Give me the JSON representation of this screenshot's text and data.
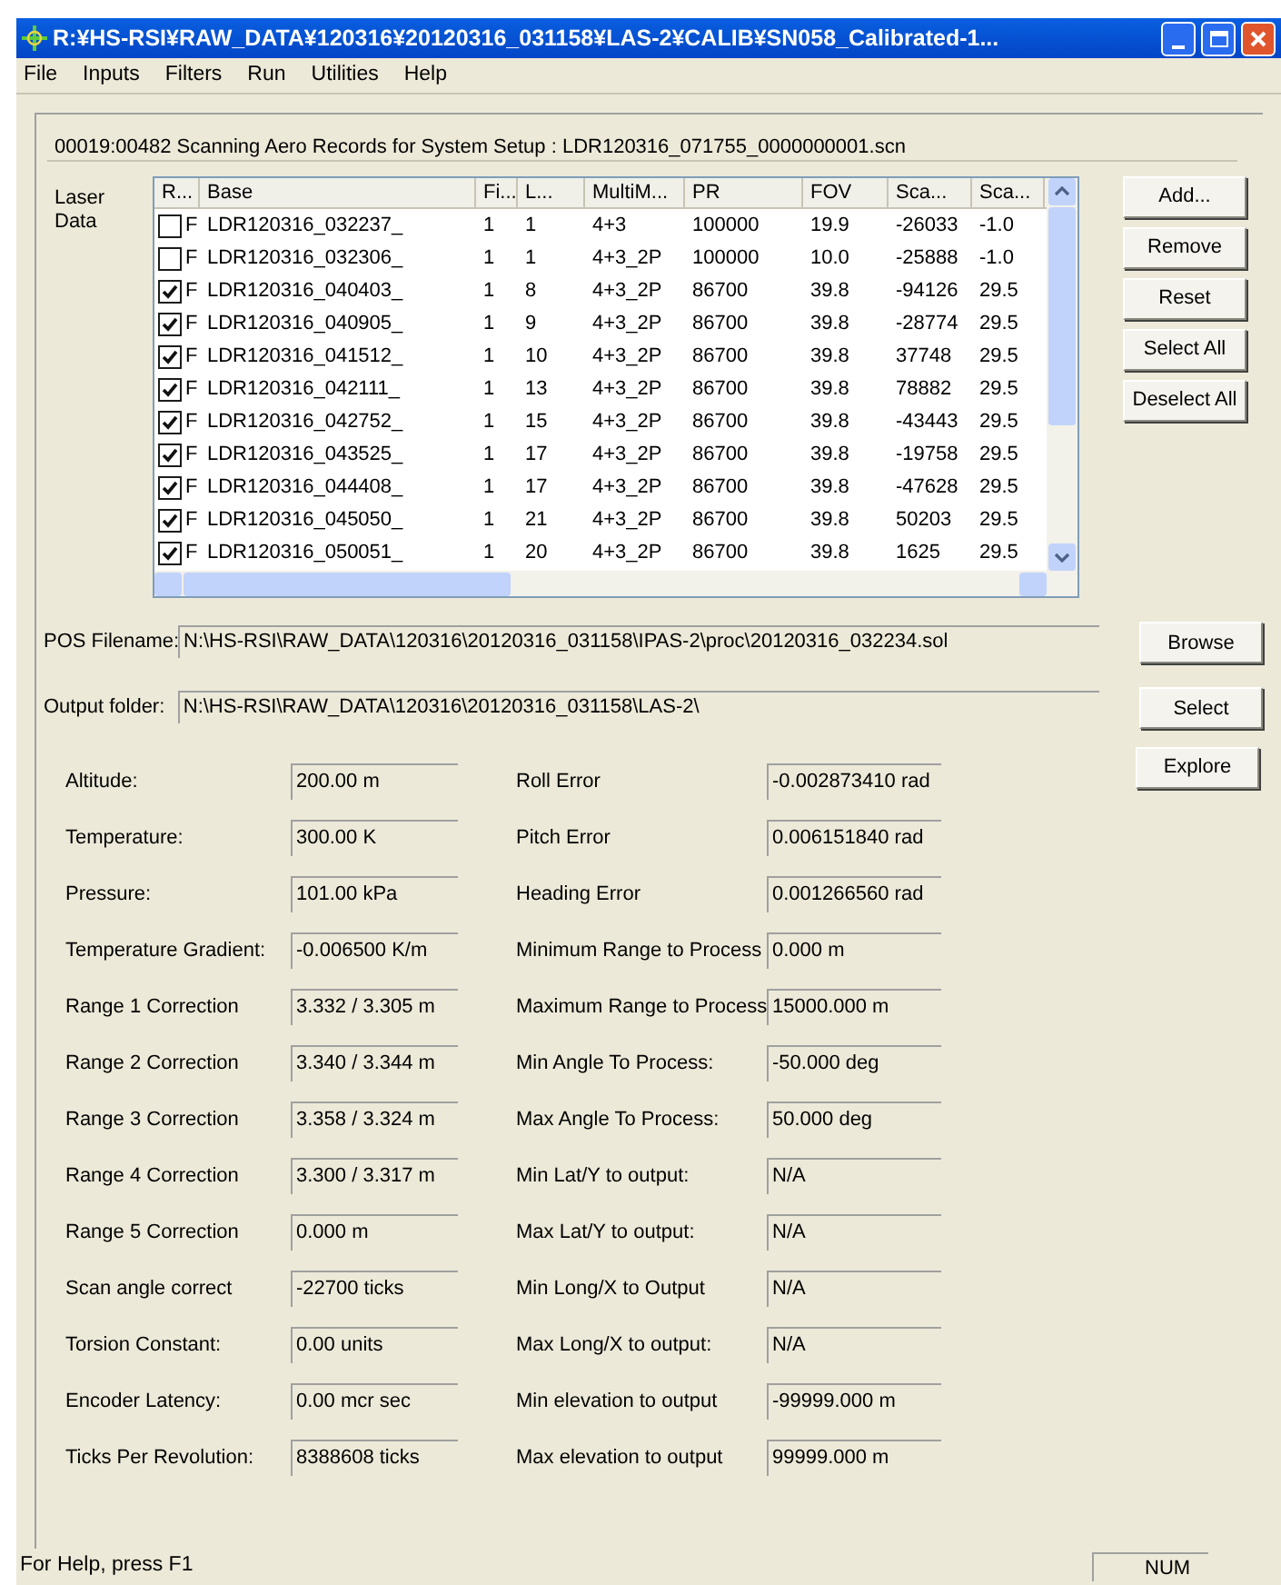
{
  "window": {
    "title": "R:¥HS-RSI¥RAW_DATA¥120316¥20120316_031158¥LAS-2¥CALIB¥SN058_Calibrated-1..."
  },
  "menu": [
    "File",
    "Inputs",
    "Filters",
    "Run",
    "Utilities",
    "Help"
  ],
  "info_line": "00019:00482  Scanning Aero Records for System Setup : LDR120316_071755_0000000001.scn",
  "laser_data": {
    "label": "Laser Data",
    "columns": [
      "R...",
      "Base",
      "Fi...",
      "L...",
      "MultiM...",
      "PR",
      "FOV",
      "Sca...",
      "Sca..."
    ],
    "rows": [
      {
        "checked": false,
        "cells": [
          "F",
          "LDR120316_032237_",
          "1",
          "1",
          "4+3",
          "100000",
          "19.9",
          "-26033",
          "-1.0"
        ]
      },
      {
        "checked": false,
        "cells": [
          "F",
          "LDR120316_032306_",
          "1",
          "1",
          "4+3_2P",
          "100000",
          "10.0",
          "-25888",
          "-1.0"
        ]
      },
      {
        "checked": true,
        "cells": [
          "F",
          "LDR120316_040403_",
          "1",
          "8",
          "4+3_2P",
          "86700",
          "39.8",
          "-94126",
          "29.5"
        ]
      },
      {
        "checked": true,
        "cells": [
          "F",
          "LDR120316_040905_",
          "1",
          "9",
          "4+3_2P",
          "86700",
          "39.8",
          "-28774",
          "29.5"
        ]
      },
      {
        "checked": true,
        "cells": [
          "F",
          "LDR120316_041512_",
          "1",
          "10",
          "4+3_2P",
          "86700",
          "39.8",
          "37748",
          "29.5"
        ]
      },
      {
        "checked": true,
        "cells": [
          "F",
          "LDR120316_042111_",
          "1",
          "13",
          "4+3_2P",
          "86700",
          "39.8",
          "78882",
          "29.5"
        ]
      },
      {
        "checked": true,
        "cells": [
          "F",
          "LDR120316_042752_",
          "1",
          "15",
          "4+3_2P",
          "86700",
          "39.8",
          "-43443",
          "29.5"
        ]
      },
      {
        "checked": true,
        "cells": [
          "F",
          "LDR120316_043525_",
          "1",
          "17",
          "4+3_2P",
          "86700",
          "39.8",
          "-19758",
          "29.5"
        ]
      },
      {
        "checked": true,
        "cells": [
          "F",
          "LDR120316_044408_",
          "1",
          "17",
          "4+3_2P",
          "86700",
          "39.8",
          "-47628",
          "29.5"
        ]
      },
      {
        "checked": true,
        "cells": [
          "F",
          "LDR120316_045050_",
          "1",
          "21",
          "4+3_2P",
          "86700",
          "39.8",
          "50203",
          "29.5"
        ]
      },
      {
        "checked": true,
        "cells": [
          "F",
          "LDR120316_050051_",
          "1",
          "20",
          "4+3_2P",
          "86700",
          "39.8",
          "1625",
          "29.5"
        ]
      }
    ],
    "buttons": [
      "Add...",
      "Remove",
      "Reset",
      "Select All",
      "Deselect All"
    ]
  },
  "pos_filename": {
    "label": "POS Filename:",
    "value": "N:\\HS-RSI\\RAW_DATA\\120316\\20120316_031158\\IPAS-2\\proc\\20120316_032234.sol",
    "button": "Browse"
  },
  "output_folder": {
    "label": "Output folder:",
    "value": "N:\\HS-RSI\\RAW_DATA\\120316\\20120316_031158\\LAS-2\\",
    "button": "Select"
  },
  "explore_button": "Explore",
  "parameters": [
    {
      "label": "Altitude:",
      "value": "200.00 m",
      "label_2": "Roll Error",
      "value_2": "-0.002873410 rad"
    },
    {
      "label": "Temperature:",
      "value": "300.00 K",
      "label_2": "Pitch Error",
      "value_2": "0.006151840 rad"
    },
    {
      "label": "Pressure:",
      "value": "101.00 kPa",
      "label_2": "Heading Error",
      "value_2": "0.001266560 rad"
    },
    {
      "label": "Temperature Gradient:",
      "value": "-0.006500 K/m",
      "label_2": "Minimum Range to Process",
      "value_2": "0.000 m"
    },
    {
      "label": "Range 1 Correction",
      "value": "3.332 / 3.305 m",
      "label_2": "Maximum Range to Process",
      "value_2": "15000.000 m"
    },
    {
      "label": "Range 2 Correction",
      "value": "3.340 / 3.344 m",
      "label_2": "Min Angle To Process:",
      "value_2": "-50.000 deg"
    },
    {
      "label": "Range 3 Correction",
      "value": "3.358 / 3.324 m",
      "label_2": "Max Angle To Process:",
      "value_2": "50.000 deg"
    },
    {
      "label": "Range 4 Correction",
      "value": "3.300 / 3.317 m",
      "label_2": "Min Lat/Y to output:",
      "value_2": "N/A"
    },
    {
      "label": "Range 5 Correction",
      "value": "0.000 m",
      "label_2": "Max Lat/Y to output:",
      "value_2": "N/A"
    },
    {
      "label": "Scan angle correct",
      "value": "-22700 ticks",
      "label_2": "Min Long/X to Output",
      "value_2": "N/A"
    },
    {
      "label": "Torsion Constant:",
      "value": "0.00 units",
      "label_2": "Max Long/X to output:",
      "value_2": "N/A"
    },
    {
      "label": "Encoder Latency:",
      "value": "0.00 mcr sec",
      "label_2": "Min elevation to output",
      "value_2": "-99999.000 m"
    },
    {
      "label": "Ticks Per Revolution:",
      "value": "8388608 ticks",
      "label_2": "Max elevation to output",
      "value_2": "99999.000 m"
    }
  ],
  "status_bar": {
    "help": "For Help, press F1",
    "indicator": "NUM"
  }
}
